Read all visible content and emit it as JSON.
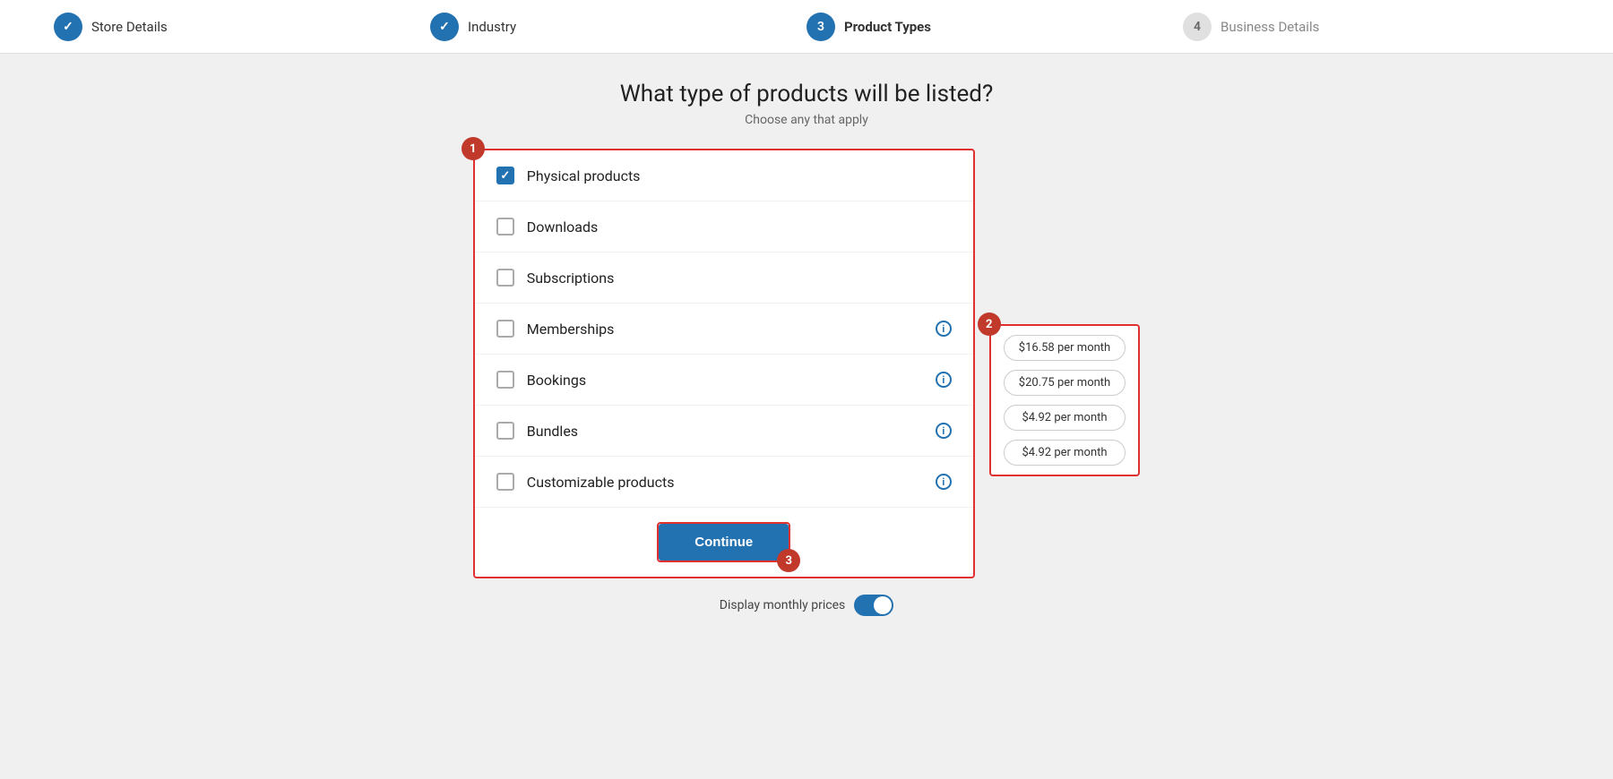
{
  "stepper": {
    "steps": [
      {
        "id": "store-details",
        "number": "✓",
        "label": "Store Details",
        "state": "done"
      },
      {
        "id": "industry",
        "number": "✓",
        "label": "Industry",
        "state": "done"
      },
      {
        "id": "product-types",
        "number": "3",
        "label": "Product Types",
        "state": "active"
      },
      {
        "id": "business-details",
        "number": "4",
        "label": "Business Details",
        "state": "inactive"
      }
    ]
  },
  "page": {
    "title": "What type of products will be listed?",
    "subtitle": "Choose any that apply"
  },
  "products": [
    {
      "id": "physical",
      "label": "Physical products",
      "checked": true,
      "info": false
    },
    {
      "id": "downloads",
      "label": "Downloads",
      "checked": false,
      "info": false
    },
    {
      "id": "subscriptions",
      "label": "Subscriptions",
      "checked": false,
      "info": false
    },
    {
      "id": "memberships",
      "label": "Memberships",
      "checked": false,
      "info": true
    },
    {
      "id": "bookings",
      "label": "Bookings",
      "checked": false,
      "info": true
    },
    {
      "id": "bundles",
      "label": "Bundles",
      "checked": false,
      "info": true
    },
    {
      "id": "customizable",
      "label": "Customizable products",
      "checked": false,
      "info": true
    }
  ],
  "prices": [
    "$16.58 per month",
    "$20.75 per month",
    "$4.92 per month",
    "$4.92 per month"
  ],
  "buttons": {
    "continue": "Continue"
  },
  "toggle": {
    "label": "Display monthly prices",
    "enabled": true
  },
  "badges": {
    "b1": "1",
    "b2": "2",
    "b3": "3"
  },
  "icons": {
    "checkmark": "✓",
    "info": "i"
  }
}
